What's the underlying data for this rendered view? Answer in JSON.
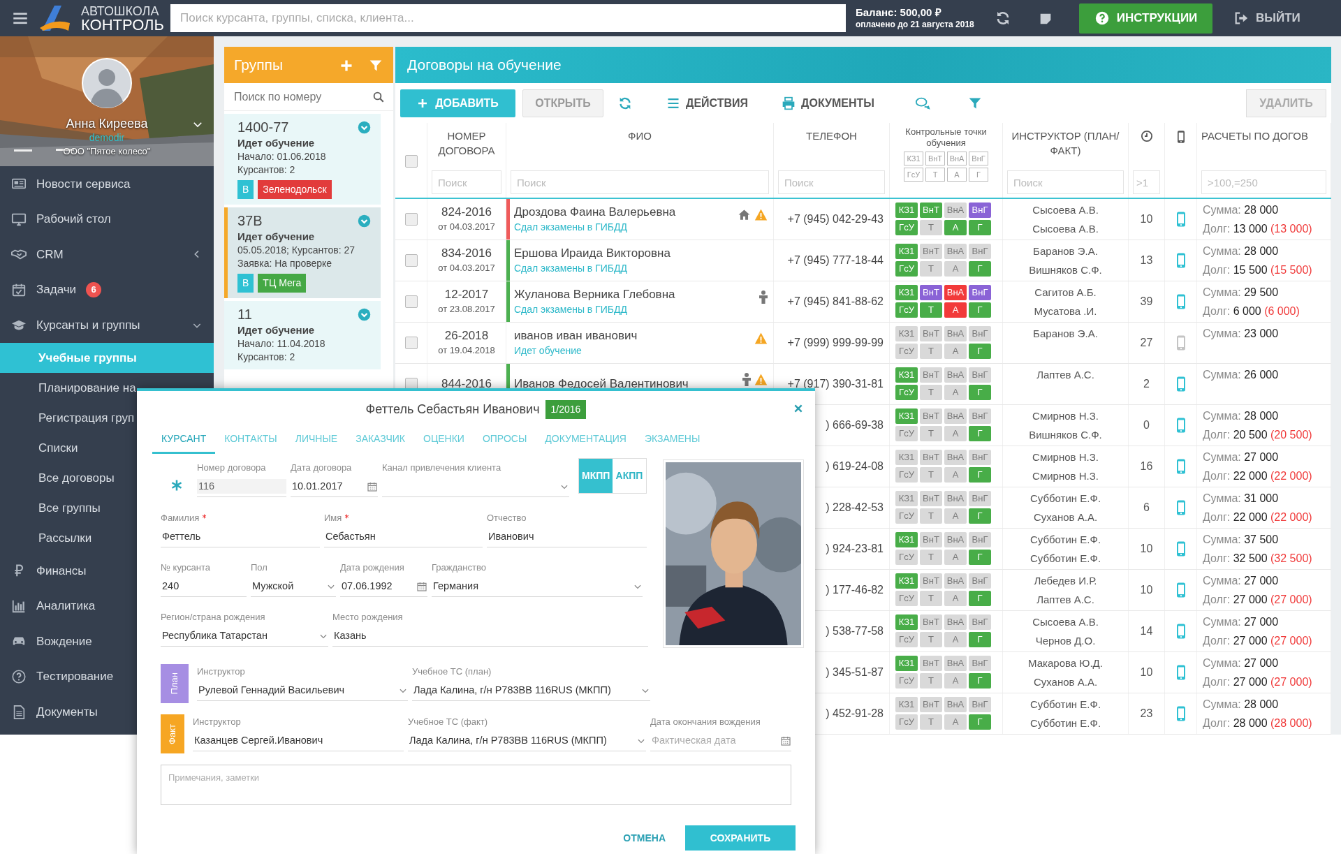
{
  "topbar": {
    "logo_top": "АВТОШКОЛА",
    "logo_bottom": "КОНТРОЛЬ",
    "search": {
      "placeholder": "Поиск курсанта, группы, списка, клиента..."
    },
    "balance": "Баланс: 500,00 ₽",
    "paid_until": "оплачено до 21 августа 2018",
    "help_button": "ИНСТРУКЦИИ",
    "logout": "ВЫЙТИ"
  },
  "profile": {
    "name": "Анна Киреева",
    "login": "demodir",
    "company": "ООО \"Пятое колесо\""
  },
  "sidebar": {
    "items": [
      {
        "label": "Новости сервиса",
        "kind": "link",
        "selected": false
      },
      {
        "label": "Рабочий стол",
        "kind": "link",
        "selected": false
      },
      {
        "label": "CRM",
        "kind": "group",
        "expanded": false,
        "selected": false
      },
      {
        "label": "Задачи",
        "kind": "link",
        "badge": "6",
        "selected": false
      },
      {
        "label": "Курсанты и группы",
        "kind": "group",
        "expanded": true,
        "selected": false,
        "children": [
          {
            "label": "Учебные группы",
            "selected": true
          },
          {
            "label": "Планирование на",
            "selected": false
          },
          {
            "label": "Регистрация груп",
            "selected": false
          },
          {
            "label": "Списки",
            "selected": false
          },
          {
            "label": "Все договоры",
            "selected": false
          },
          {
            "label": "Все группы",
            "selected": false
          },
          {
            "label": "Рассылки",
            "selected": false
          }
        ]
      },
      {
        "label": "Финансы",
        "kind": "link",
        "selected": false
      },
      {
        "label": "Аналитика",
        "kind": "link",
        "selected": false
      },
      {
        "label": "Вождение",
        "kind": "link",
        "selected": false
      },
      {
        "label": "Тестирование",
        "kind": "link",
        "selected": false
      },
      {
        "label": "Документы",
        "kind": "link",
        "selected": false
      }
    ]
  },
  "groups": {
    "title": "Группы",
    "search": {
      "placeholder": "Поиск по номеру"
    },
    "items": [
      {
        "number": "1400-77",
        "status": "Идет обучение",
        "lines": [
          "Начало: 01.06.2018",
          "Курсантов: 2"
        ],
        "tags": [
          {
            "label": "В",
            "color": "#2fc1d3"
          },
          {
            "label": "Зеленодольск",
            "color": "#e23b3b"
          }
        ],
        "selected": false
      },
      {
        "number": "37В",
        "status": "Идет обучение",
        "lines": [
          "05.05.2018; Курсантов: 27",
          "Заявка: На проверке"
        ],
        "tags": [
          {
            "label": "В",
            "color": "#2fc1d3"
          },
          {
            "label": "ТЦ Мега",
            "color": "#45a845"
          }
        ],
        "selected": true
      },
      {
        "number": "11",
        "status": "Идет обучение",
        "lines": [
          "Начало: 11.04.2018",
          "Курсантов: 2"
        ],
        "selected": false
      }
    ]
  },
  "contracts": {
    "title": "Договоры на обучение",
    "toolbar": {
      "add": "ДОБАВИТЬ",
      "open": "ОТКРЫТЬ",
      "actions": "ДЕЙСТВИЯ",
      "documents": "ДОКУМЕНТЫ",
      "delete": "УДАЛИТЬ"
    },
    "select_all_checked": false,
    "columns": {
      "number": "НОМЕР ДОГОВОРА",
      "fio": "ФИО",
      "phone": "ТЕЛЕФОН",
      "checkpoints": "Контрольные точки обучения",
      "instructor": "ИНСТРУКТОР (ПЛАН/ФАКТ)",
      "sums": "РАСЧЕТЫ ПО ДОГОВ"
    },
    "checkpoint_legend": [
      "КЗ1",
      "ВнТ",
      "ВнА",
      "ВнГ",
      "ГсУ",
      "Т",
      "А",
      "Г"
    ],
    "filters": {
      "number": {
        "placeholder": "Поиск"
      },
      "fio": {
        "placeholder": "Поиск"
      },
      "phone": {
        "placeholder": "Поиск"
      },
      "instructor": {
        "placeholder": "Поиск"
      },
      "hours": {
        "placeholder": ">1"
      },
      "sums": {
        "placeholder": ">100,=250"
      }
    },
    "rows": [
      {
        "checked": false,
        "number": "824-2016",
        "date": "от 04.03.2017",
        "color": "#ef5b5b",
        "name": "Дроздова Фаина Валерьевна",
        "status": "Сдал экзамены в ГИБДД",
        "home": true,
        "person": false,
        "warning": true,
        "phone": "+7 (945) 042-29-43",
        "checkpoints": [
          {
            "label": "КЗ1",
            "color": "#48ad48"
          },
          {
            "label": "ВнТ",
            "color": "#48ad48"
          },
          {
            "label": "ВнА",
            "color": "#d9d9d9"
          },
          {
            "label": "ВнГ",
            "color": "#8a63d6"
          },
          {
            "label": "ГсУ",
            "color": "#48ad48"
          },
          {
            "label": "Т",
            "color": "#d9d9d9"
          },
          {
            "label": "А",
            "color": "#48ad48"
          },
          {
            "label": "Г",
            "color": "#48ad48"
          }
        ],
        "instructors": [
          "Сысоева А.В.",
          "Сысоева А.В."
        ],
        "hours": "10",
        "app": true,
        "sum_label": "Сумма:",
        "sum": "28 000",
        "debt_label": "Долг:",
        "debt": "13 000",
        "debt_due": "(13 000)"
      },
      {
        "checked": false,
        "number": "834-2016",
        "date": "от 04.03.2017",
        "color": "#4cb050",
        "name": "Ершова Ираида Викторовна",
        "status": "Сдал экзамены в ГИБДД",
        "home": false,
        "person": false,
        "warning": false,
        "phone": "+7 (945) 777-18-44",
        "checkpoints": [
          {
            "label": "КЗ1",
            "color": "#48ad48"
          },
          {
            "label": "ВнТ",
            "color": "#d9d9d9"
          },
          {
            "label": "ВнА",
            "color": "#d9d9d9"
          },
          {
            "label": "ВнГ",
            "color": "#d9d9d9"
          },
          {
            "label": "ГсУ",
            "color": "#48ad48"
          },
          {
            "label": "Т",
            "color": "#d9d9d9"
          },
          {
            "label": "А",
            "color": "#d9d9d9"
          },
          {
            "label": "Г",
            "color": "#48ad48"
          }
        ],
        "instructors": [
          "Баранов Э.А.",
          "Вишняков С.Ф."
        ],
        "hours": "13",
        "app": true,
        "sum_label": "Сумма:",
        "sum": "28 000",
        "debt_label": "Долг:",
        "debt": "15 500",
        "debt_due": "(15 500)"
      },
      {
        "checked": false,
        "number": "12-2017",
        "date": "от 23.08.2017",
        "color": "#4cb050",
        "name": "Жуланова Верника Глебовна",
        "status": "Сдал экзамены в ГИБДД",
        "home": false,
        "person": true,
        "warning": false,
        "phone": "+7 (945) 841-88-62",
        "checkpoints": [
          {
            "label": "КЗ1",
            "color": "#48ad48"
          },
          {
            "label": "ВнТ",
            "color": "#8a63d6"
          },
          {
            "label": "ВнА",
            "color": "#f23a3a"
          },
          {
            "label": "ВнГ",
            "color": "#8a63d6"
          },
          {
            "label": "ГсУ",
            "color": "#48ad48"
          },
          {
            "label": "Т",
            "color": "#48ad48"
          },
          {
            "label": "А",
            "color": "#f23a3a"
          },
          {
            "label": "Г",
            "color": "#48ad48"
          }
        ],
        "instructors": [
          "Сагитов А.Б.",
          "Мусатова .И."
        ],
        "hours": "39",
        "app": true,
        "sum_label": "Сумма:",
        "sum": "29 500",
        "debt_label": "Долг:",
        "debt": "6 000",
        "debt_due": "(6 000)"
      },
      {
        "checked": false,
        "number": "26-2018",
        "date": "от 19.04.2018",
        "name": "иванов иван иванович",
        "status": "Идет обучение",
        "home": false,
        "person": false,
        "warning": true,
        "phone": "+7 (999) 999-99-99",
        "checkpoints": [
          {
            "label": "КЗ1",
            "color": "#d9d9d9"
          },
          {
            "label": "ВнТ",
            "color": "#d9d9d9"
          },
          {
            "label": "ВнА",
            "color": "#d9d9d9"
          },
          {
            "label": "ВнГ",
            "color": "#d9d9d9"
          },
          {
            "label": "ГсУ",
            "color": "#d9d9d9"
          },
          {
            "label": "Т",
            "color": "#d9d9d9"
          },
          {
            "label": "А",
            "color": "#d9d9d9"
          },
          {
            "label": "Г",
            "color": "#48ad48"
          }
        ],
        "instructors": [
          "Баранов Э.А."
        ],
        "hours": "27",
        "app": false,
        "sum_label": "Сумма:",
        "sum": "23 000"
      },
      {
        "checked": false,
        "number": "844-2016",
        "color": "#4cb050",
        "name": "Иванов Федосей Валентинович",
        "home": false,
        "person": true,
        "warning": true,
        "phone": "+7 (917) 390-31-81",
        "checkpoints": [
          {
            "label": "КЗ1",
            "color": "#48ad48"
          },
          {
            "label": "ВнТ",
            "color": "#d9d9d9"
          },
          {
            "label": "ВнА",
            "color": "#d9d9d9"
          },
          {
            "label": "ВнГ",
            "color": "#d9d9d9"
          },
          {
            "label": "ГсУ",
            "color": "#48ad48"
          },
          {
            "label": "Т",
            "color": "#d9d9d9"
          },
          {
            "label": "А",
            "color": "#d9d9d9"
          },
          {
            "label": "Г",
            "color": "#48ad48"
          }
        ],
        "instructors": [
          "Лаптев А.С."
        ],
        "hours": "2",
        "app": true,
        "sum_label": "Сумма:",
        "sum": "26 000"
      },
      {
        "phone": ") 666-69-38",
        "checkpoints": [
          {
            "label": "КЗ1",
            "color": "#48ad48"
          },
          {
            "label": "ВнТ",
            "color": "#d9d9d9"
          },
          {
            "label": "ВнА",
            "color": "#d9d9d9"
          },
          {
            "label": "ВнГ",
            "color": "#d9d9d9"
          },
          {
            "label": "ГсУ",
            "color": "#d9d9d9"
          },
          {
            "label": "Т",
            "color": "#d9d9d9"
          },
          {
            "label": "А",
            "color": "#d9d9d9"
          },
          {
            "label": "Г",
            "color": "#48ad48"
          }
        ],
        "instructors": [
          "Смирнов Н.З.",
          "Вишняков С.Ф."
        ],
        "hours": "0",
        "app": true,
        "sum_label": "Сумма:",
        "sum": "28 000",
        "debt_label": "Долг:",
        "debt": "20 500",
        "debt_due": "(20 500)"
      },
      {
        "phone": ") 619-24-08",
        "checkpoints": [
          {
            "label": "КЗ1",
            "color": "#d9d9d9"
          },
          {
            "label": "ВнТ",
            "color": "#d9d9d9"
          },
          {
            "label": "ВнА",
            "color": "#d9d9d9"
          },
          {
            "label": "ВнГ",
            "color": "#d9d9d9"
          },
          {
            "label": "ГсУ",
            "color": "#d9d9d9"
          },
          {
            "label": "Т",
            "color": "#d9d9d9"
          },
          {
            "label": "А",
            "color": "#d9d9d9"
          },
          {
            "label": "Г",
            "color": "#48ad48"
          }
        ],
        "instructors": [
          "Смирнов Н.З.",
          "Смирнов Н.З."
        ],
        "hours": "16",
        "app": true,
        "sum_label": "Сумма:",
        "sum": "27 000",
        "debt_label": "Долг:",
        "debt": "22 000",
        "debt_due": "(22 000)"
      },
      {
        "phone": ") 228-42-53",
        "checkpoints": [
          {
            "label": "КЗ1",
            "color": "#d9d9d9"
          },
          {
            "label": "ВнТ",
            "color": "#d9d9d9"
          },
          {
            "label": "ВнА",
            "color": "#d9d9d9"
          },
          {
            "label": "ВнГ",
            "color": "#d9d9d9"
          },
          {
            "label": "ГсУ",
            "color": "#d9d9d9"
          },
          {
            "label": "Т",
            "color": "#d9d9d9"
          },
          {
            "label": "А",
            "color": "#d9d9d9"
          },
          {
            "label": "Г",
            "color": "#48ad48"
          }
        ],
        "instructors": [
          "Субботин Е.Ф.",
          "Суханов А.А."
        ],
        "hours": "6",
        "app": true,
        "sum_label": "Сумма:",
        "sum": "31 000",
        "debt_label": "Долг:",
        "debt": "22 000",
        "debt_due": "(22 000)"
      },
      {
        "phone": ") 924-23-81",
        "checkpoints": [
          {
            "label": "КЗ1",
            "color": "#48ad48"
          },
          {
            "label": "ВнТ",
            "color": "#d9d9d9"
          },
          {
            "label": "ВнА",
            "color": "#d9d9d9"
          },
          {
            "label": "ВнГ",
            "color": "#d9d9d9"
          },
          {
            "label": "ГсУ",
            "color": "#d9d9d9"
          },
          {
            "label": "Т",
            "color": "#d9d9d9"
          },
          {
            "label": "А",
            "color": "#d9d9d9"
          },
          {
            "label": "Г",
            "color": "#48ad48"
          }
        ],
        "instructors": [
          "Субботин Е.Ф.",
          "Субботин Е.Ф."
        ],
        "hours": "10",
        "app": true,
        "sum_label": "Сумма:",
        "sum": "37 500",
        "debt_label": "Долг:",
        "debt": "32 500",
        "debt_due": "(32 500)"
      },
      {
        "phone": ") 177-46-82",
        "checkpoints": [
          {
            "label": "КЗ1",
            "color": "#48ad48"
          },
          {
            "label": "ВнТ",
            "color": "#d9d9d9"
          },
          {
            "label": "ВнА",
            "color": "#d9d9d9"
          },
          {
            "label": "ВнГ",
            "color": "#d9d9d9"
          },
          {
            "label": "ГсУ",
            "color": "#d9d9d9"
          },
          {
            "label": "Т",
            "color": "#d9d9d9"
          },
          {
            "label": "А",
            "color": "#d9d9d9"
          },
          {
            "label": "Г",
            "color": "#48ad48"
          }
        ],
        "instructors": [
          "Лебедев И.Р.",
          "Лаптев А.С."
        ],
        "hours": "10",
        "app": true,
        "sum_label": "Сумма:",
        "sum": "27 000",
        "debt_label": "Долг:",
        "debt": "27 000",
        "debt_due": "(27 000)"
      },
      {
        "phone": ") 538-77-58",
        "checkpoints": [
          {
            "label": "КЗ1",
            "color": "#48ad48"
          },
          {
            "label": "ВнТ",
            "color": "#d9d9d9"
          },
          {
            "label": "ВнА",
            "color": "#d9d9d9"
          },
          {
            "label": "ВнГ",
            "color": "#d9d9d9"
          },
          {
            "label": "ГсУ",
            "color": "#d9d9d9"
          },
          {
            "label": "Т",
            "color": "#d9d9d9"
          },
          {
            "label": "А",
            "color": "#d9d9d9"
          },
          {
            "label": "Г",
            "color": "#48ad48"
          }
        ],
        "instructors": [
          "Сысоева А.В.",
          "Чернов Д.О."
        ],
        "hours": "14",
        "app": true,
        "sum_label": "Сумма:",
        "sum": "27 000",
        "debt_label": "Долг:",
        "debt": "27 000",
        "debt_due": "(27 000)"
      },
      {
        "phone": ") 345-51-87",
        "checkpoints": [
          {
            "label": "КЗ1",
            "color": "#48ad48"
          },
          {
            "label": "ВнТ",
            "color": "#d9d9d9"
          },
          {
            "label": "ВнА",
            "color": "#d9d9d9"
          },
          {
            "label": "ВнГ",
            "color": "#d9d9d9"
          },
          {
            "label": "ГсУ",
            "color": "#d9d9d9"
          },
          {
            "label": "Т",
            "color": "#d9d9d9"
          },
          {
            "label": "А",
            "color": "#d9d9d9"
          },
          {
            "label": "Г",
            "color": "#48ad48"
          }
        ],
        "instructors": [
          "Макарова Ю.Д.",
          "Суханов А.А."
        ],
        "hours": "10",
        "app": true,
        "sum_label": "Сумма:",
        "sum": "27 000",
        "debt_label": "Долг:",
        "debt": "27 000",
        "debt_due": "(27 000)"
      },
      {
        "phone": ") 452-91-28",
        "checkpoints": [
          {
            "label": "КЗ1",
            "color": "#d9d9d9"
          },
          {
            "label": "ВнТ",
            "color": "#d9d9d9"
          },
          {
            "label": "ВнА",
            "color": "#d9d9d9"
          },
          {
            "label": "ВнГ",
            "color": "#d9d9d9"
          },
          {
            "label": "ГсУ",
            "color": "#d9d9d9"
          },
          {
            "label": "Т",
            "color": "#d9d9d9"
          },
          {
            "label": "А",
            "color": "#d9d9d9"
          },
          {
            "label": "Г",
            "color": "#48ad48"
          }
        ],
        "instructors": [
          "Субботин Е.Ф.",
          "Субботин Е.Ф."
        ],
        "hours": "23",
        "app": true,
        "sum_label": "Сумма:",
        "sum": "28 000",
        "debt_label": "Долг:",
        "debt": "28 000",
        "debt_due": "(28 000)"
      }
    ]
  },
  "modal": {
    "title": "Феттель Себастьян Иванович",
    "badge": "1/2016",
    "tabs": [
      {
        "label": "КУРСАНТ",
        "selected": true
      },
      {
        "label": "КОНТАКТЫ",
        "selected": false
      },
      {
        "label": "ЛИЧНЫЕ",
        "selected": false
      },
      {
        "label": "ЗАКАЗЧИК",
        "selected": false
      },
      {
        "label": "ОЦЕНКИ",
        "selected": false
      },
      {
        "label": "ОПРОСЫ",
        "selected": false
      },
      {
        "label": "ДОКУМЕНТАЦИЯ",
        "selected": false
      },
      {
        "label": "ЭКЗАМЕНЫ",
        "selected": false
      }
    ],
    "form": [
      [
        {
          "label": "Номер договора",
          "value": "116",
          "kind": "text",
          "disabled": true
        },
        {
          "label": "Дата договора",
          "value": "10.01.2017",
          "kind": "date"
        },
        {
          "label": "Канал привлечения клиента",
          "kind": "select"
        }
      ],
      [
        {
          "label": "Фамилия",
          "value": "Феттель",
          "kind": "text",
          "required": true
        },
        {
          "label": "Имя",
          "value": "Себастьян",
          "kind": "text",
          "required": true
        },
        {
          "label": "Отчество",
          "value": "Иванович",
          "kind": "text"
        }
      ],
      [
        {
          "label": "№ курсанта",
          "value": "240",
          "kind": "text"
        },
        {
          "label": "Пол",
          "value": "Мужской",
          "kind": "select"
        },
        {
          "label": "Дата рождения",
          "value": "07.06.1992",
          "kind": "date"
        },
        {
          "label": "Гражданство",
          "value": "Германия",
          "kind": "select"
        }
      ],
      [
        {
          "label": "Регион/страна рождения",
          "value": "Республика Татарстан",
          "kind": "select"
        },
        {
          "label": "Место рождения",
          "value": "Казань",
          "kind": "text"
        }
      ]
    ],
    "gearbox": [
      {
        "label": "МКПП",
        "selected": true
      },
      {
        "label": "АКПП",
        "selected": false
      }
    ],
    "assignments": [
      {
        "tag": "План",
        "kind": "plan",
        "fields": [
          {
            "label": "Инструктор",
            "value": "Рулевой Геннадий Васильевич",
            "kind": "select"
          },
          {
            "label": "Учебное ТС (план)",
            "value": "Лада Калина, г/н Р783ВВ 116RUS (МКПП)",
            "kind": "select"
          }
        ]
      },
      {
        "tag": "Факт",
        "kind": "fact",
        "fields": [
          {
            "label": "Инструктор",
            "value": "Казанцев Сергей.Иванович",
            "kind": "text"
          },
          {
            "label": "Учебное ТС (факт)",
            "value": "Лада Калина, г/н Р783ВВ 116RUS (МКПП)",
            "kind": "select"
          },
          {
            "label": "Дата окончания вождения",
            "placeholder": "Фактическая дата",
            "kind": "date"
          }
        ]
      }
    ],
    "notes": {
      "placeholder": "Примечания, заметки"
    },
    "cancel": "ОТМЕНА",
    "save": "СОХРАНИТЬ"
  }
}
